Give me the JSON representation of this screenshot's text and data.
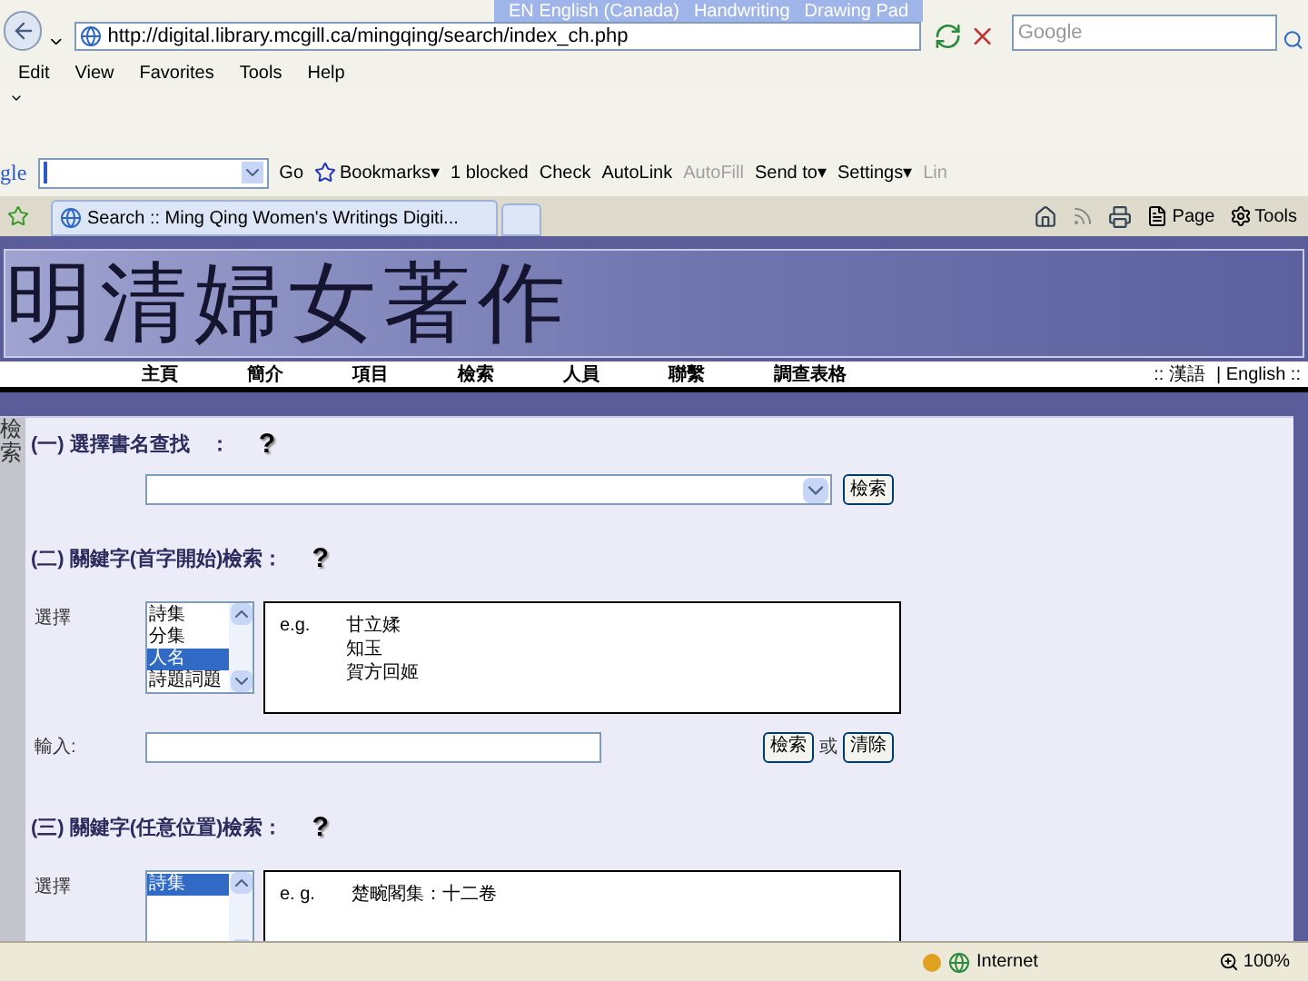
{
  "address_bar": {
    "url": "http://digital.library.mcgill.ca/mingqing/search/index_ch.php",
    "search_placeholder": "Google"
  },
  "language_bar": {
    "code": "EN",
    "language": "English (Canada)",
    "tools": [
      "Handwriting",
      "Drawing Pad"
    ]
  },
  "menu": [
    "Edit",
    "View",
    "Favorites",
    "Tools",
    "Help"
  ],
  "google_toolbar": {
    "logo": "gle",
    "items": [
      {
        "label": "Go",
        "disabled": false
      },
      {
        "label": "Bookmarks▾",
        "disabled": false
      },
      {
        "label": "1 blocked",
        "disabled": false
      },
      {
        "label": "Check",
        "disabled": false
      },
      {
        "label": "AutoLink",
        "disabled": false
      },
      {
        "label": "AutoFill",
        "disabled": true
      },
      {
        "label": "Send to▾",
        "disabled": false
      },
      {
        "label": "Settings▾",
        "disabled": false
      },
      {
        "label": "Lin",
        "disabled": true
      }
    ]
  },
  "tabs": [
    {
      "label": "Search :: Ming Qing Women's Writings Digiti...",
      "selected": true
    }
  ],
  "command_bar": [
    "Page",
    "Tools"
  ],
  "site": {
    "title": "明清婦女著作",
    "nav": [
      "主頁",
      "簡介",
      "項目",
      "檢索",
      "人員",
      "聯繫",
      "調查表格"
    ],
    "languages": [
      ":: 漢語",
      "| English ::"
    ]
  },
  "sidebar_label": "檢索",
  "sections": [
    {
      "kind": "title_select",
      "heading": "(一) 選擇書名查找　：",
      "help": "?",
      "button": "檢索"
    },
    {
      "kind": "keyword",
      "heading": "(二) 關鍵字(首字開始)檢索：",
      "help": "?",
      "select_label": "選擇",
      "options": [
        {
          "label": "詩集",
          "selected": false
        },
        {
          "label": "分集",
          "selected": false
        },
        {
          "label": "人名",
          "selected": true
        },
        {
          "label": "詩題詞題",
          "selected": false
        }
      ],
      "example_label": "e.g.",
      "examples": [
        "甘立媃",
        "知玉",
        "賀方回姬"
      ],
      "input_label": "輸入:",
      "buttons": [
        "檢索",
        "清除"
      ],
      "or_text": "或"
    },
    {
      "kind": "keyword",
      "heading": "(三) 關鍵字(任意位置)檢索：",
      "help": "?",
      "select_label": "選擇",
      "options": [
        {
          "label": "詩集",
          "selected": true
        }
      ],
      "example_label": "e. g.",
      "examples": [
        "楚畹閣集：十二卷"
      ]
    }
  ],
  "status_bar": {
    "zone": "Internet",
    "zoom": "100%"
  }
}
